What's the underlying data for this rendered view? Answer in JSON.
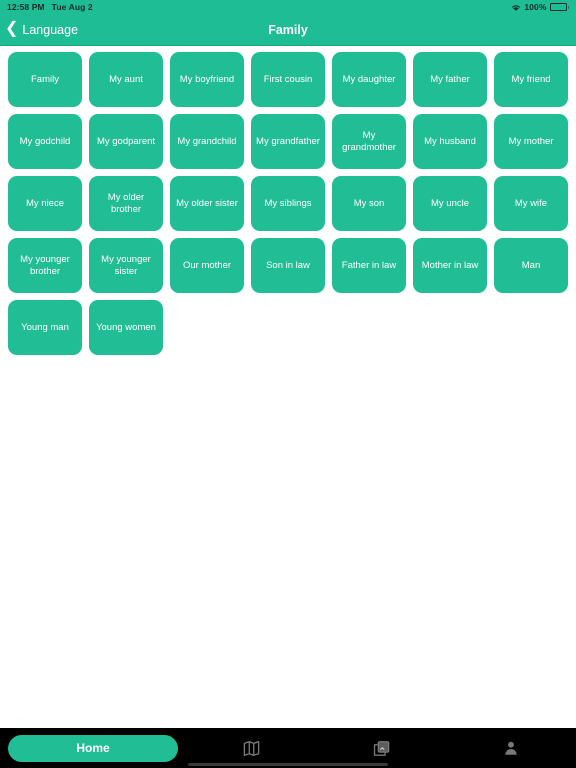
{
  "status_bar": {
    "time": "12:58 PM",
    "date": "Tue Aug 2",
    "battery_percent": "100%",
    "wifi_icon": "wifi-icon",
    "battery_icon": "battery-full-icon"
  },
  "nav": {
    "back_label": "Language",
    "back_icon": "chevron-left-icon",
    "title": "Family"
  },
  "theme": {
    "accent": "#21bd95",
    "header": "#1ebd95",
    "tab_bar_bg": "#000000",
    "tile_text": "#ffffff"
  },
  "grid": {
    "columns": 7,
    "tiles": [
      {
        "label": "Family"
      },
      {
        "label": "My aunt"
      },
      {
        "label": "My boyfriend"
      },
      {
        "label": "First cousin"
      },
      {
        "label": "My daughter"
      },
      {
        "label": "My father"
      },
      {
        "label": "My friend"
      },
      {
        "label": "My godchild"
      },
      {
        "label": "My godparent"
      },
      {
        "label": "My grandchild"
      },
      {
        "label": "My grandfather"
      },
      {
        "label": "My grandmother"
      },
      {
        "label": "My husband"
      },
      {
        "label": "My mother"
      },
      {
        "label": "My niece"
      },
      {
        "label": "My older brother"
      },
      {
        "label": "My older sister"
      },
      {
        "label": "My siblings"
      },
      {
        "label": "My son"
      },
      {
        "label": "My uncle"
      },
      {
        "label": "My wife"
      },
      {
        "label": "My younger brother"
      },
      {
        "label": "My younger sister"
      },
      {
        "label": "Our mother"
      },
      {
        "label": "Son in law"
      },
      {
        "label": "Father in law"
      },
      {
        "label": "Mother in law"
      },
      {
        "label": "Man"
      },
      {
        "label": "Young man"
      },
      {
        "label": "Young women"
      }
    ]
  },
  "tab_bar": {
    "items": [
      {
        "label": "Home",
        "icon": "home-icon",
        "active": true
      },
      {
        "label": "",
        "icon": "book-icon",
        "active": false
      },
      {
        "label": "",
        "icon": "photos-icon",
        "active": false
      },
      {
        "label": "",
        "icon": "person-icon",
        "active": false
      }
    ]
  }
}
